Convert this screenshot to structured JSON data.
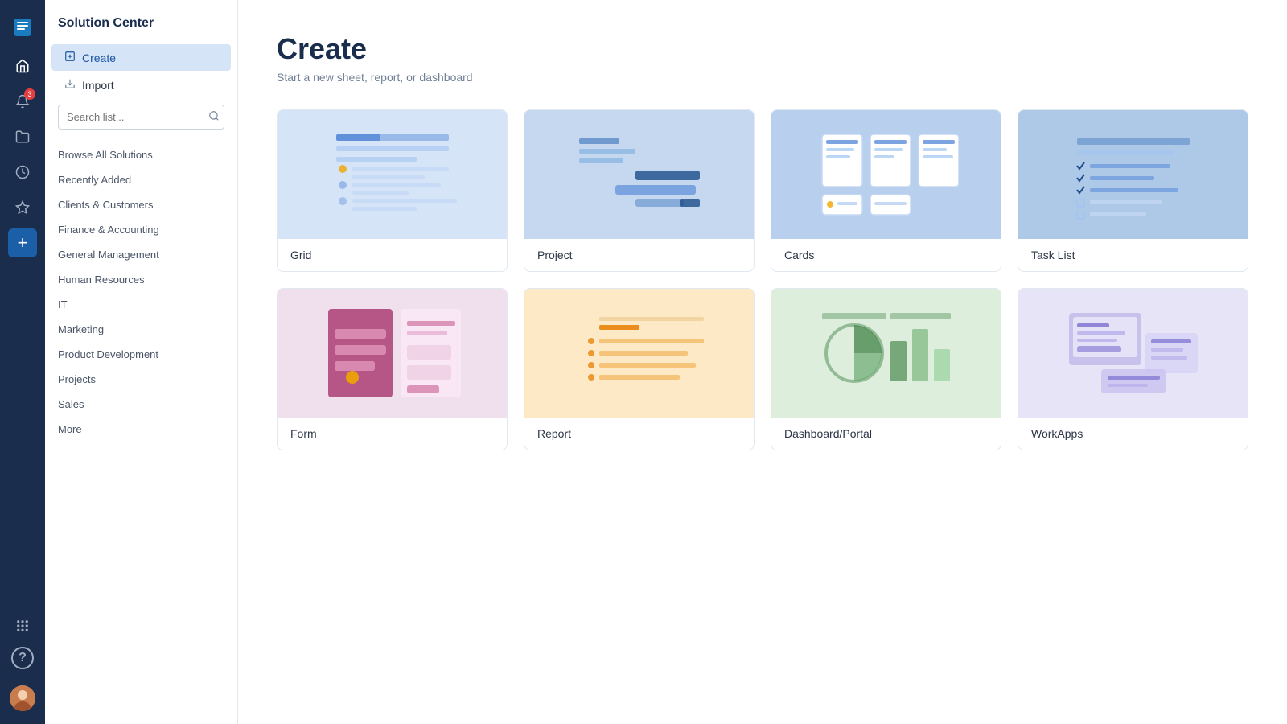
{
  "app": {
    "logo": "smartsheet"
  },
  "nav": {
    "icons": [
      {
        "name": "home-icon",
        "symbol": "⌂",
        "active": true
      },
      {
        "name": "notifications-icon",
        "symbol": "🔔",
        "badge": "3"
      },
      {
        "name": "browse-icon",
        "symbol": "📁"
      },
      {
        "name": "recents-icon",
        "symbol": "🕐"
      },
      {
        "name": "favorites-icon",
        "symbol": "★"
      },
      {
        "name": "create-icon",
        "symbol": "+",
        "active": true
      }
    ],
    "bottom": [
      {
        "name": "apps-icon",
        "symbol": "⊞"
      },
      {
        "name": "help-icon",
        "symbol": "?"
      }
    ],
    "avatar": "👤"
  },
  "sidebar": {
    "title": "Solution Center",
    "nav_items": [
      {
        "label": "Create",
        "active": true,
        "icon": "📄"
      },
      {
        "label": "Import",
        "active": false,
        "icon": "↪"
      }
    ],
    "search_placeholder": "Search list...",
    "list_items": [
      "Browse All Solutions",
      "Recently Added",
      "Clients & Customers",
      "Finance & Accounting",
      "General Management",
      "Human Resources",
      "IT",
      "Marketing",
      "Product Development",
      "Projects",
      "Sales",
      "More"
    ]
  },
  "main": {
    "title": "Create",
    "subtitle": "Start a new sheet, report, or dashboard",
    "cards": [
      {
        "label": "Grid",
        "bg_class": "grid-bg",
        "type": "grid"
      },
      {
        "label": "Project",
        "bg_class": "project-bg",
        "type": "project"
      },
      {
        "label": "Cards",
        "bg_class": "cards-bg",
        "type": "cards"
      },
      {
        "label": "Task List",
        "bg_class": "tasklist-bg",
        "type": "tasklist"
      },
      {
        "label": "Form",
        "bg_class": "form-bg",
        "type": "form"
      },
      {
        "label": "Report",
        "bg_class": "report-bg",
        "type": "report"
      },
      {
        "label": "Dashboard/Portal",
        "bg_class": "dashboard-bg",
        "type": "dashboard"
      },
      {
        "label": "WorkApps",
        "bg_class": "workapps-bg",
        "type": "workapps"
      }
    ]
  }
}
